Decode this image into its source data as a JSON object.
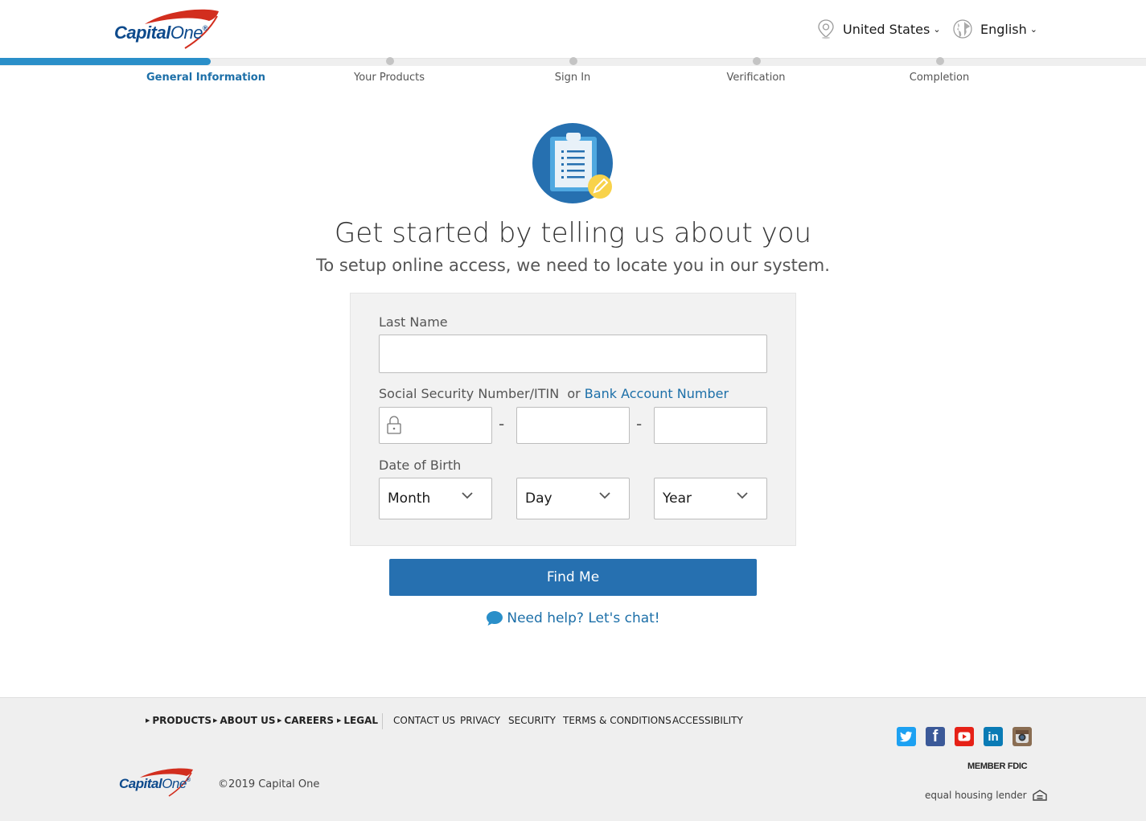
{
  "header": {
    "logo_text_a": "Capital",
    "logo_text_b": "One",
    "country": "United States",
    "language": "English"
  },
  "steps": [
    {
      "label": "General Information",
      "active": true
    },
    {
      "label": "Your Products",
      "active": false
    },
    {
      "label": "Sign In",
      "active": false
    },
    {
      "label": "Verification",
      "active": false
    },
    {
      "label": "Completion",
      "active": false
    }
  ],
  "main": {
    "title": "Get started by telling us about you",
    "subtitle": "To setup online access, we need to locate you in our system.",
    "last_name_label": "Last Name",
    "last_name_value": "",
    "ssn_label": "Social Security Number/ITIN",
    "ssn_or": "or",
    "bank_link": "Bank Account Number",
    "ssn_part1": "",
    "ssn_part2": "",
    "ssn_part3": "",
    "dash": "-",
    "dob_label": "Date of Birth",
    "month": "Month",
    "day": "Day",
    "year": "Year",
    "find_me": "Find Me",
    "chat": "Need help? Let's chat!"
  },
  "footer": {
    "nav_bold": [
      "PRODUCTS",
      "ABOUT US",
      "CAREERS",
      "LEGAL"
    ],
    "nav": [
      "CONTACT US",
      "PRIVACY",
      "SECURITY",
      "TERMS & CONDITIONS",
      "ACCESSIBILITY"
    ],
    "member_fdic": "MEMBER FDIC",
    "ehl": "equal housing lender",
    "copyright": "©2019 Capital One"
  },
  "colors": {
    "brand_blue": "#0d4a8c",
    "accent": "#2a8fc9",
    "button": "#2670b0",
    "logo_red": "#d22e1e"
  }
}
